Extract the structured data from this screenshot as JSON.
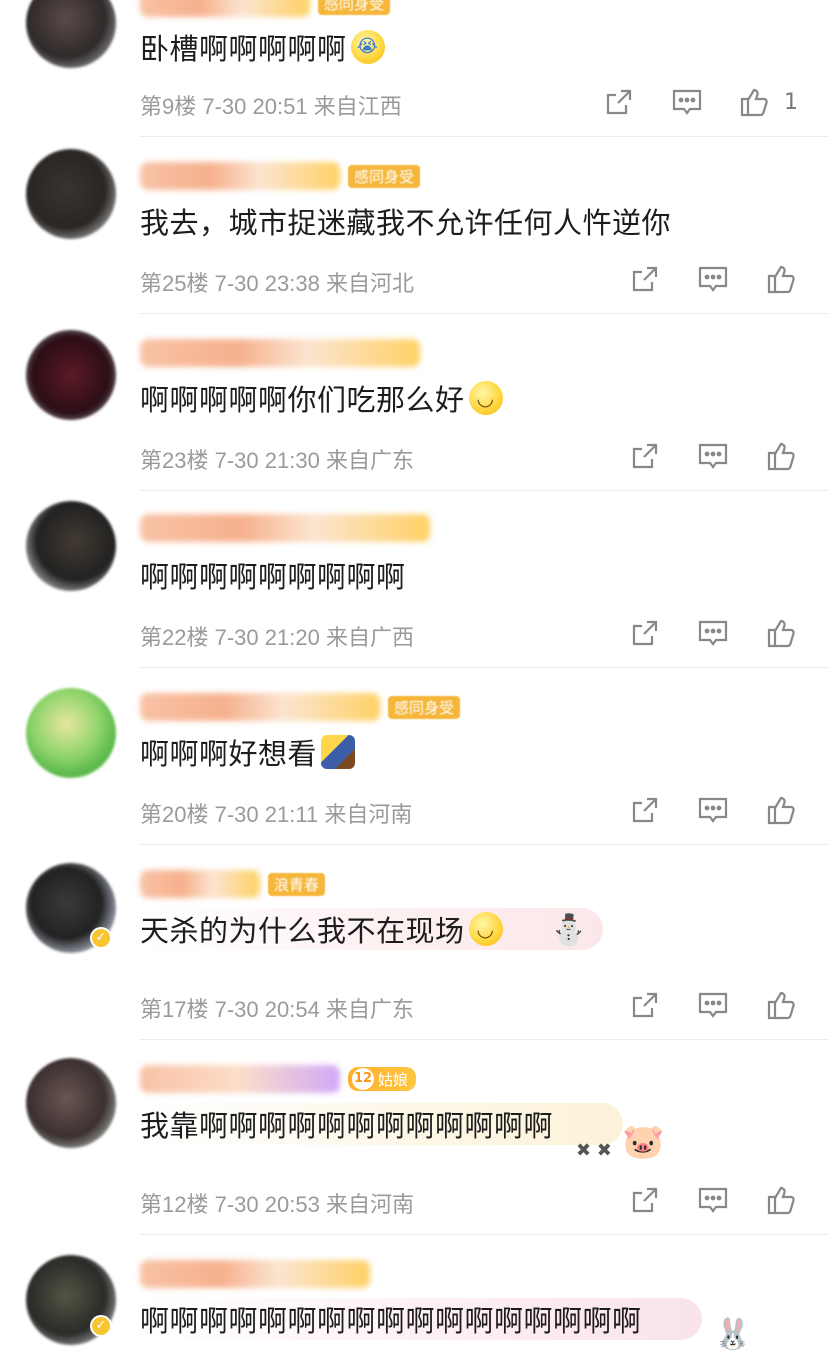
{
  "comments": [
    {
      "text": "卧槽啊啊啊啊啊",
      "emoji": "loudly-crying-face",
      "floor": "第9楼",
      "time": "7-30 20:51",
      "location": "来自江西",
      "likes": "1",
      "tag": "感同身受"
    },
    {
      "text": "我去，城市捉迷藏我不允许任何人忤逆你",
      "floor": "第25楼",
      "time": "7-30 23:38",
      "location": "来自河北",
      "likes": "",
      "tag": "感同身受"
    },
    {
      "text": "啊啊啊啊啊你们吃那么好",
      "emoji": "smile",
      "floor": "第23楼",
      "time": "7-30 21:30",
      "location": "来自广东",
      "likes": ""
    },
    {
      "text": "啊啊啊啊啊啊啊啊啊",
      "floor": "第22楼",
      "time": "7-30 21:20",
      "location": "来自广西",
      "likes": ""
    },
    {
      "text": "啊啊啊好想看",
      "emoji": "lying-man",
      "floor": "第20楼",
      "time": "7-30 21:11",
      "location": "来自河南",
      "likes": "",
      "tag": "感同身受"
    },
    {
      "text": "天杀的为什么我不在现场",
      "emoji": "smile",
      "floor": "第17楼",
      "time": "7-30 20:54",
      "location": "来自广东",
      "likes": "",
      "tag": "浪青春",
      "bubble": "snowman"
    },
    {
      "text": "我靠啊啊啊啊啊啊啊啊啊啊啊啊",
      "floor": "第12楼",
      "time": "7-30 20:53",
      "location": "来自河南",
      "likes": "",
      "level": "12",
      "level_label": "姑娘",
      "bubble": "piglet"
    },
    {
      "text": "啊啊啊啊啊啊啊啊啊啊啊啊啊啊啊啊啊",
      "bubble": "bunny"
    }
  ],
  "icons": {
    "share": "share-icon",
    "comment": "comment-icon",
    "like": "thumbs-up-icon"
  },
  "colors": {
    "meta_text": "#9a9a9a",
    "badge_gold": "#f5b63a",
    "divider": "#ececec"
  }
}
